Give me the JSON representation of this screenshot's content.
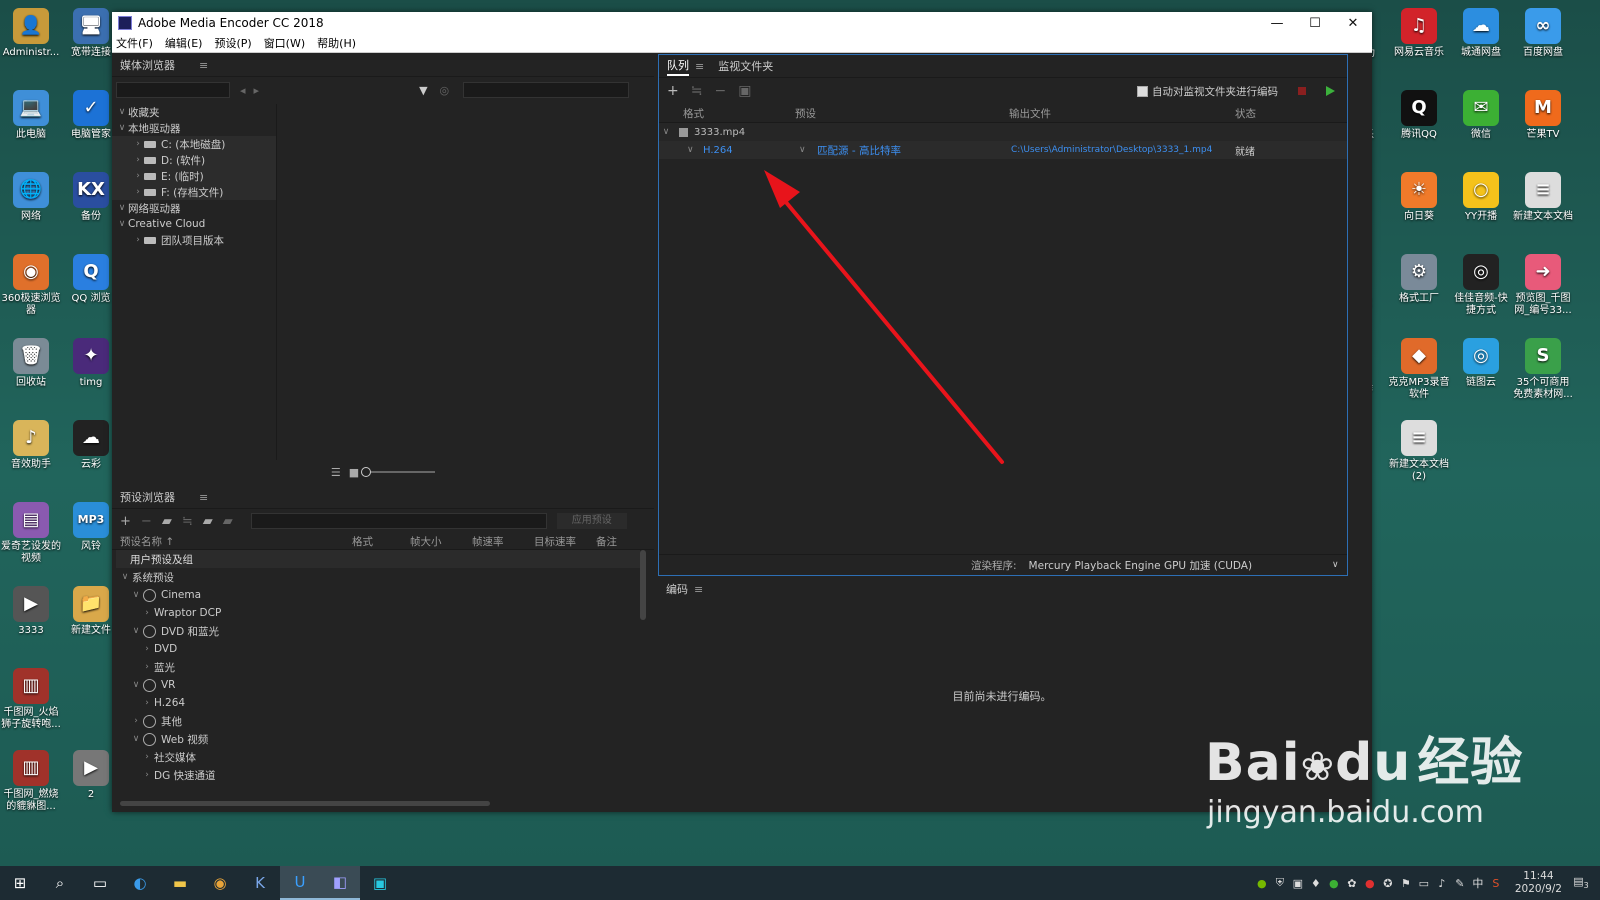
{
  "window": {
    "title": "Adobe Media Encoder CC 2018",
    "minimize": "—",
    "maximize": "☐",
    "close": "✕"
  },
  "menu": [
    "文件(F)",
    "编辑(E)",
    "预设(P)",
    "窗口(W)",
    "帮助(H)"
  ],
  "media_browser": {
    "title": "媒体浏览器",
    "search_placeholder": "",
    "tree": [
      {
        "label": "收藏夹",
        "level": 0,
        "expanded": true
      },
      {
        "label": "本地驱动器",
        "level": 0,
        "expanded": true
      },
      {
        "label": "C: (本地磁盘)",
        "level": 1
      },
      {
        "label": "D: (软件)",
        "level": 1
      },
      {
        "label": "E: (临时)",
        "level": 1
      },
      {
        "label": "F: (存档文件)",
        "level": 1
      },
      {
        "label": "网络驱动器",
        "level": 0,
        "expanded": true
      },
      {
        "label": "Creative Cloud",
        "level": 0,
        "expanded": true
      },
      {
        "label": "团队项目版本",
        "level": 1
      }
    ]
  },
  "preset_browser": {
    "title": "预设浏览器",
    "apply_label": "应用预设",
    "columns": [
      "预设名称 ↑",
      "格式",
      "帧大小",
      "帧速率",
      "目标速率",
      "备注"
    ],
    "rows": [
      {
        "label": "用户预设及组",
        "level": 0,
        "header": true
      },
      {
        "label": "系统预设",
        "level": 0,
        "chev": "∨"
      },
      {
        "label": "Cinema",
        "level": 1,
        "chev": "∨",
        "icon": true
      },
      {
        "label": "Wraptor DCP",
        "level": 2,
        "chev": "›"
      },
      {
        "label": "DVD 和蓝光",
        "level": 1,
        "chev": "∨",
        "icon": true
      },
      {
        "label": "DVD",
        "level": 2,
        "chev": "›"
      },
      {
        "label": "蓝光",
        "level": 2,
        "chev": "›"
      },
      {
        "label": "VR",
        "level": 1,
        "chev": "∨",
        "icon": true
      },
      {
        "label": "H.264",
        "level": 2,
        "chev": "›"
      },
      {
        "label": "其他",
        "level": 1,
        "chev": "›",
        "icon": true
      },
      {
        "label": "Web 视频",
        "level": 1,
        "chev": "∨",
        "icon": true
      },
      {
        "label": "社交媒体",
        "level": 2,
        "chev": "›"
      },
      {
        "label": "DG 快速通道",
        "level": 2,
        "chev": "›"
      }
    ]
  },
  "queue": {
    "tab_active": "队列",
    "tab_other": "监视文件夹",
    "auto_encode_label": "自动对监视文件夹进行编码",
    "columns": {
      "format": "格式",
      "preset": "预设",
      "output": "输出文件",
      "status": "状态"
    },
    "items": [
      {
        "file": "3333.mp4",
        "format": "H.264",
        "preset": "匹配源 - 高比特率",
        "output": "C:\\Users\\Administrator\\Desktop\\3333_1.mp4",
        "status": "就绪"
      }
    ],
    "renderer_label": "渲染程序:",
    "renderer_value": "Mercury Playback Engine GPU 加速 (CUDA)"
  },
  "encoding": {
    "title": "编码",
    "message": "目前尚未进行编码。"
  },
  "desktop_icons_left": [
    {
      "label": "Administr...",
      "color": "#c79a3a",
      "glyph": "👤"
    },
    {
      "label": "宽带连接",
      "color": "#3b6fb0",
      "glyph": "🖥"
    },
    {
      "label": "此电脑",
      "color": "#3f8fd8",
      "glyph": "💻"
    },
    {
      "label": "电脑管家",
      "color": "#1c72d6",
      "glyph": "✓"
    },
    {
      "label": "网络",
      "color": "#3f8fd8",
      "glyph": "🌐"
    },
    {
      "label": "备份",
      "color": "#2a4ea0",
      "glyph": "KX"
    },
    {
      "label": "360极速浏览器",
      "color": "#e0702b",
      "glyph": "◉"
    },
    {
      "label": "QQ 浏览",
      "color": "#2a7fe0",
      "glyph": "Q"
    },
    {
      "label": "回收站",
      "color": "#7b8b96",
      "glyph": "🗑"
    },
    {
      "label": "timg",
      "color": "#4a2a7a",
      "glyph": "✦"
    },
    {
      "label": "音效助手",
      "color": "#d9b55a",
      "glyph": "♪"
    },
    {
      "label": "云彩",
      "color": "#222",
      "glyph": "☁"
    },
    {
      "label": "爱奇艺设发的视频",
      "color": "#8a5ab0",
      "glyph": "▤"
    },
    {
      "label": "风铃",
      "color": "#2a8ed8",
      "glyph": "MP3"
    },
    {
      "label": "3333",
      "color": "#555",
      "glyph": "▶"
    },
    {
      "label": "新建文件",
      "color": "#d9a84a",
      "glyph": "📁"
    },
    {
      "label": "千图网_火焰狮子旋转咆...",
      "color": "#a0322a",
      "glyph": "▥"
    },
    {
      "label": "千图网_燃烧的貔貅图...",
      "color": "#a0322a",
      "glyph": "▥"
    },
    {
      "label": "2",
      "color": "#777",
      "glyph": "▶"
    }
  ],
  "desktop_icons_right": [
    {
      "label": "网易云音乐",
      "color": "#d2232a",
      "glyph": "♫"
    },
    {
      "label": "城通网盘",
      "color": "#2c8ee0",
      "glyph": "☁"
    },
    {
      "label": "百度网盘",
      "color": "#3a9bea",
      "glyph": "∞"
    },
    {
      "label": "腾讯QQ",
      "color": "#111",
      "glyph": "Q"
    },
    {
      "label": "微信",
      "color": "#3cb034",
      "glyph": "✉"
    },
    {
      "label": "芒果TV",
      "color": "#ef6a1c",
      "glyph": "M"
    },
    {
      "label": "向日葵",
      "color": "#f07a2a",
      "glyph": "☀"
    },
    {
      "label": "YY开播",
      "color": "#f5c21b",
      "glyph": "○"
    },
    {
      "label": "新建文本文档",
      "color": "#ddd",
      "glyph": "≡"
    },
    {
      "label": "格式工厂",
      "color": "#7a8a99",
      "glyph": "⚙"
    },
    {
      "label": "佳佳音频-快捷方式",
      "color": "#222",
      "glyph": "◎"
    },
    {
      "label": "预览图_千图网_编号33...",
      "color": "#e85a7a",
      "glyph": "➜"
    },
    {
      "label": "克克MP3录音软件",
      "color": "#e06a2a",
      "glyph": "◆"
    },
    {
      "label": "链图云",
      "color": "#2aa0e0",
      "glyph": "◎"
    },
    {
      "label": "35个可商用免费素材网...",
      "color": "#3aa04a",
      "glyph": "S"
    },
    {
      "label": "新建文本文档(2)",
      "color": "#ddd",
      "glyph": "≡"
    }
  ],
  "partial_icon_labels": [
    "本助",
    "乐",
    "CX",
    "制作"
  ],
  "watermark": {
    "brand": "Bai",
    "brand2": "du",
    "suffix": "经验",
    "url": "jingyan.baidu.com"
  },
  "taskbar": {
    "time": "11:44",
    "date": "2020/9/2",
    "ime": "中",
    "notify_count": "3"
  },
  "colors": {
    "accent": "#3d8ff0",
    "arrow": "#e8141b",
    "stop": "#8a1f1f",
    "play": "#3cb13c"
  }
}
